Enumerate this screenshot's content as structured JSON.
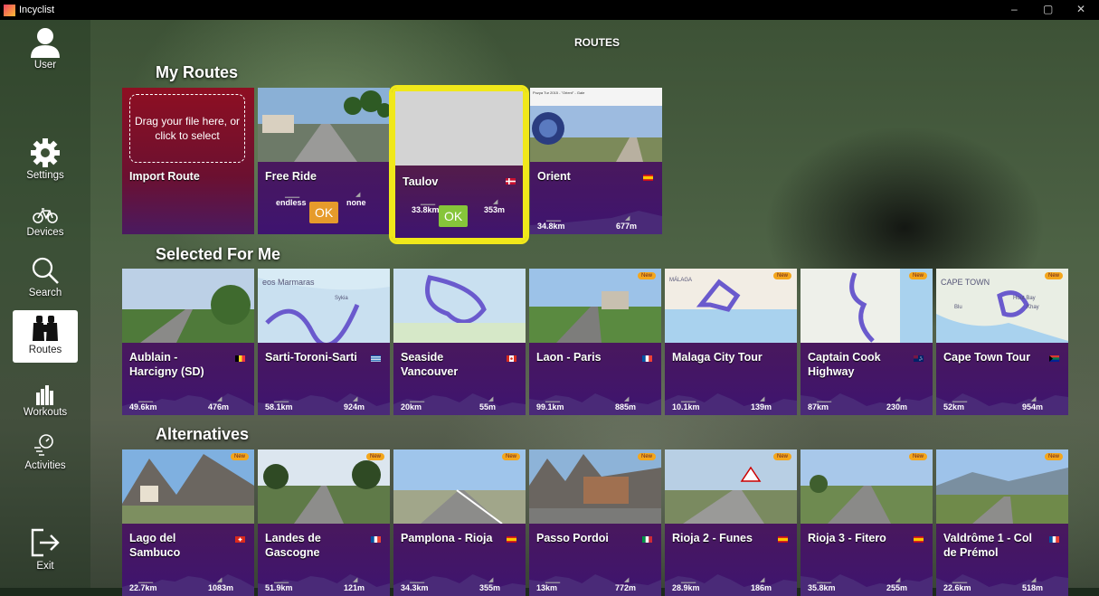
{
  "window": {
    "title": "Incyclist",
    "minimize": "–",
    "maximize": "▢",
    "close": "✕"
  },
  "page_title": "ROUTES",
  "nav": [
    {
      "label": "User",
      "icon": "user-icon"
    },
    {
      "label": "Settings",
      "icon": "gear-icon"
    },
    {
      "label": "Devices",
      "icon": "bicycle-icon"
    },
    {
      "label": "Search",
      "icon": "search-icon"
    },
    {
      "label": "Routes",
      "icon": "binoculars-icon",
      "active": true
    },
    {
      "label": "Workouts",
      "icon": "bar-chart-icon"
    },
    {
      "label": "Activities",
      "icon": "activities-icon"
    },
    {
      "label": "Exit",
      "icon": "exit-icon"
    }
  ],
  "sections": {
    "my_routes": "My Routes",
    "selected": "Selected For Me",
    "alternatives": "Alternatives"
  },
  "my_routes": [
    {
      "name": "Import Route",
      "drop_text": "Drag your file here, or click to select"
    },
    {
      "name": "Free Ride",
      "distance": "endless",
      "elevation": "none",
      "ok": "OK"
    },
    {
      "name": "Taulov",
      "distance": "33.8km",
      "elevation": "353m",
      "ok": "OK",
      "flag": "dk"
    },
    {
      "name": "Orient",
      "distance": "34.8km",
      "elevation": "677m",
      "flag": "es",
      "thumb_text": "Pozya Tur 2015 - \"Orient\" - Gale"
    }
  ],
  "selected": [
    {
      "name": "Aublain - Harcigny (SD)",
      "distance": "49.6km",
      "elevation": "476m",
      "flag": "be"
    },
    {
      "name": "Sarti-Toroni-Sarti",
      "distance": "58.1km",
      "elevation": "924m",
      "flag": "gr",
      "map_labels": [
        "eos Marmaras",
        "Sykia"
      ]
    },
    {
      "name": "Seaside Vancouver",
      "distance": "20km",
      "elevation": "55m",
      "flag": "ca"
    },
    {
      "name": "Laon - Paris",
      "distance": "99.1km",
      "elevation": "885m",
      "flag": "fr",
      "badge": "New"
    },
    {
      "name": "Malaga City Tour",
      "distance": "10.1km",
      "elevation": "139m",
      "badge": "New",
      "map_labels": [
        "MÁLAGA"
      ]
    },
    {
      "name": "Captain Cook Highway",
      "distance": "87km",
      "elevation": "230m",
      "flag": "au",
      "badge": "New"
    },
    {
      "name": "Cape Town Tour",
      "distance": "52km",
      "elevation": "954m",
      "flag": "za",
      "badge": "New",
      "map_labels": [
        "CAPE TOWN",
        "Hout Bay",
        "Blu",
        "Khay"
      ]
    }
  ],
  "alternatives": [
    {
      "name": "Lago del Sambuco",
      "distance": "22.7km",
      "elevation": "1083m",
      "flag": "ch",
      "badge": "New"
    },
    {
      "name": "Landes de Gascogne",
      "distance": "51.9km",
      "elevation": "121m",
      "flag": "fr",
      "badge": "New"
    },
    {
      "name": "Pamplona - Rioja",
      "distance": "34.3km",
      "elevation": "355m",
      "flag": "es",
      "badge": "New"
    },
    {
      "name": "Passo Pordoi",
      "distance": "13km",
      "elevation": "772m",
      "flag": "it",
      "badge": "New"
    },
    {
      "name": "Rioja 2 - Funes",
      "distance": "28.9km",
      "elevation": "186m",
      "flag": "es",
      "badge": "New"
    },
    {
      "name": "Rioja 3 - Fitero",
      "distance": "35.8km",
      "elevation": "255m",
      "flag": "es",
      "badge": "New"
    },
    {
      "name": "Valdrôme 1 - Col de Prémol",
      "distance": "22.6km",
      "elevation": "518m",
      "flag": "fr",
      "badge": "New"
    }
  ],
  "colors": {
    "accent_selected": "#f0e81a",
    "ok_orange": "#e69b2b",
    "ok_green": "#86c53a",
    "card_purple": "#3e1470"
  }
}
